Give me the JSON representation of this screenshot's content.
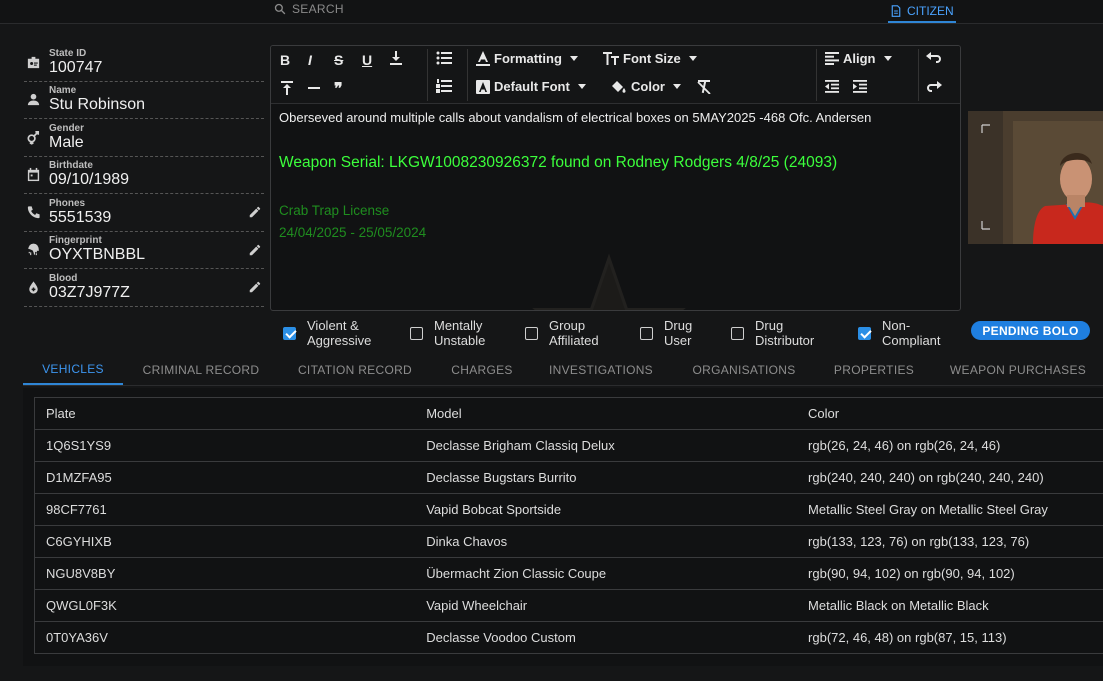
{
  "header": {
    "search_label": "SEARCH",
    "citizen_tab": "CITIZEN"
  },
  "profile": {
    "fields": [
      {
        "label": "State ID",
        "value": "100747",
        "icon": "id-badge-icon",
        "editable": false
      },
      {
        "label": "Name",
        "value": "Stu Robinson",
        "icon": "person-icon",
        "editable": false
      },
      {
        "label": "Gender",
        "value": "Male",
        "icon": "gender-icon",
        "editable": false
      },
      {
        "label": "Birthdate",
        "value": "09/10/1989",
        "icon": "calendar-icon",
        "editable": false
      },
      {
        "label": "Phones",
        "value": "5551539",
        "icon": "phone-icon",
        "editable": true
      },
      {
        "label": "Fingerprint",
        "value": "OYXTBNBBL",
        "icon": "fingerprint-icon",
        "editable": true
      },
      {
        "label": "Blood",
        "value": "03Z7J977Z",
        "icon": "blood-drop-icon",
        "editable": true
      }
    ]
  },
  "editor": {
    "toolbar": {
      "formatting": "Formatting",
      "font_size": "Font Size",
      "align": "Align",
      "default_font": "Default Font",
      "color": "Color"
    },
    "lines": [
      "Oberseved around multiple calls about vandalism of electrical boxes on 5MAY2025 -468 Ofc. Andersen",
      "Weapon Serial: LKGW1008230926372 found on Rodney Rodgers  4/8/25 (24093)",
      "Crab Trap License",
      "24/04/2025 - 25/05/2024"
    ],
    "colors": {
      "text": "#eeeeee",
      "green_bright": "#3cff3c",
      "green_dark": "#1f8d1f"
    }
  },
  "flags": {
    "items": [
      {
        "label": "Violent & Aggressive",
        "checked": true
      },
      {
        "label": "Mentally Unstable",
        "checked": false
      },
      {
        "label": "Group Affiliated",
        "checked": false
      },
      {
        "label": "Drug User",
        "checked": false
      },
      {
        "label": "Drug Distributor",
        "checked": false
      },
      {
        "label": "Non-Compliant",
        "checked": true
      }
    ],
    "badge": "PENDING BOLO"
  },
  "tabs": [
    {
      "label": "VEHICLES",
      "active": true
    },
    {
      "label": "CRIMINAL RECORD",
      "active": false
    },
    {
      "label": "CITATION RECORD",
      "active": false
    },
    {
      "label": "CHARGES",
      "active": false
    },
    {
      "label": "INVESTIGATIONS",
      "active": false
    },
    {
      "label": "ORGANISATIONS",
      "active": false
    },
    {
      "label": "PROPERTIES",
      "active": false
    },
    {
      "label": "WEAPON PURCHASES",
      "active": false
    }
  ],
  "vehicles": {
    "columns": [
      "Plate",
      "Model",
      "Color"
    ],
    "rows": [
      [
        "1Q6S1YS9",
        "Declasse Brigham Classiq Delux",
        "rgb(26, 24, 46) on rgb(26, 24, 46)"
      ],
      [
        "D1MZFA95",
        "Declasse Bugstars Burrito",
        "rgb(240, 240, 240) on rgb(240, 240, 240)"
      ],
      [
        "98CF7761",
        "Vapid Bobcat Sportside",
        "Metallic Steel Gray on Metallic Steel Gray"
      ],
      [
        "C6GYHIXB",
        "Dinka Chavos",
        "rgb(133, 123, 76) on rgb(133, 123, 76)"
      ],
      [
        "NGU8V8BY",
        "Übermacht Zion Classic Coupe",
        "rgb(90, 94, 102) on rgb(90, 94, 102)"
      ],
      [
        "QWGL0F3K",
        "Vapid Wheelchair",
        "Metallic Black on Metallic Black"
      ],
      [
        "0T0YA36V",
        "Declasse Voodoo Custom",
        "rgb(72, 46, 48) on rgb(87, 15, 113)"
      ]
    ]
  },
  "accent": "#2f86d6"
}
